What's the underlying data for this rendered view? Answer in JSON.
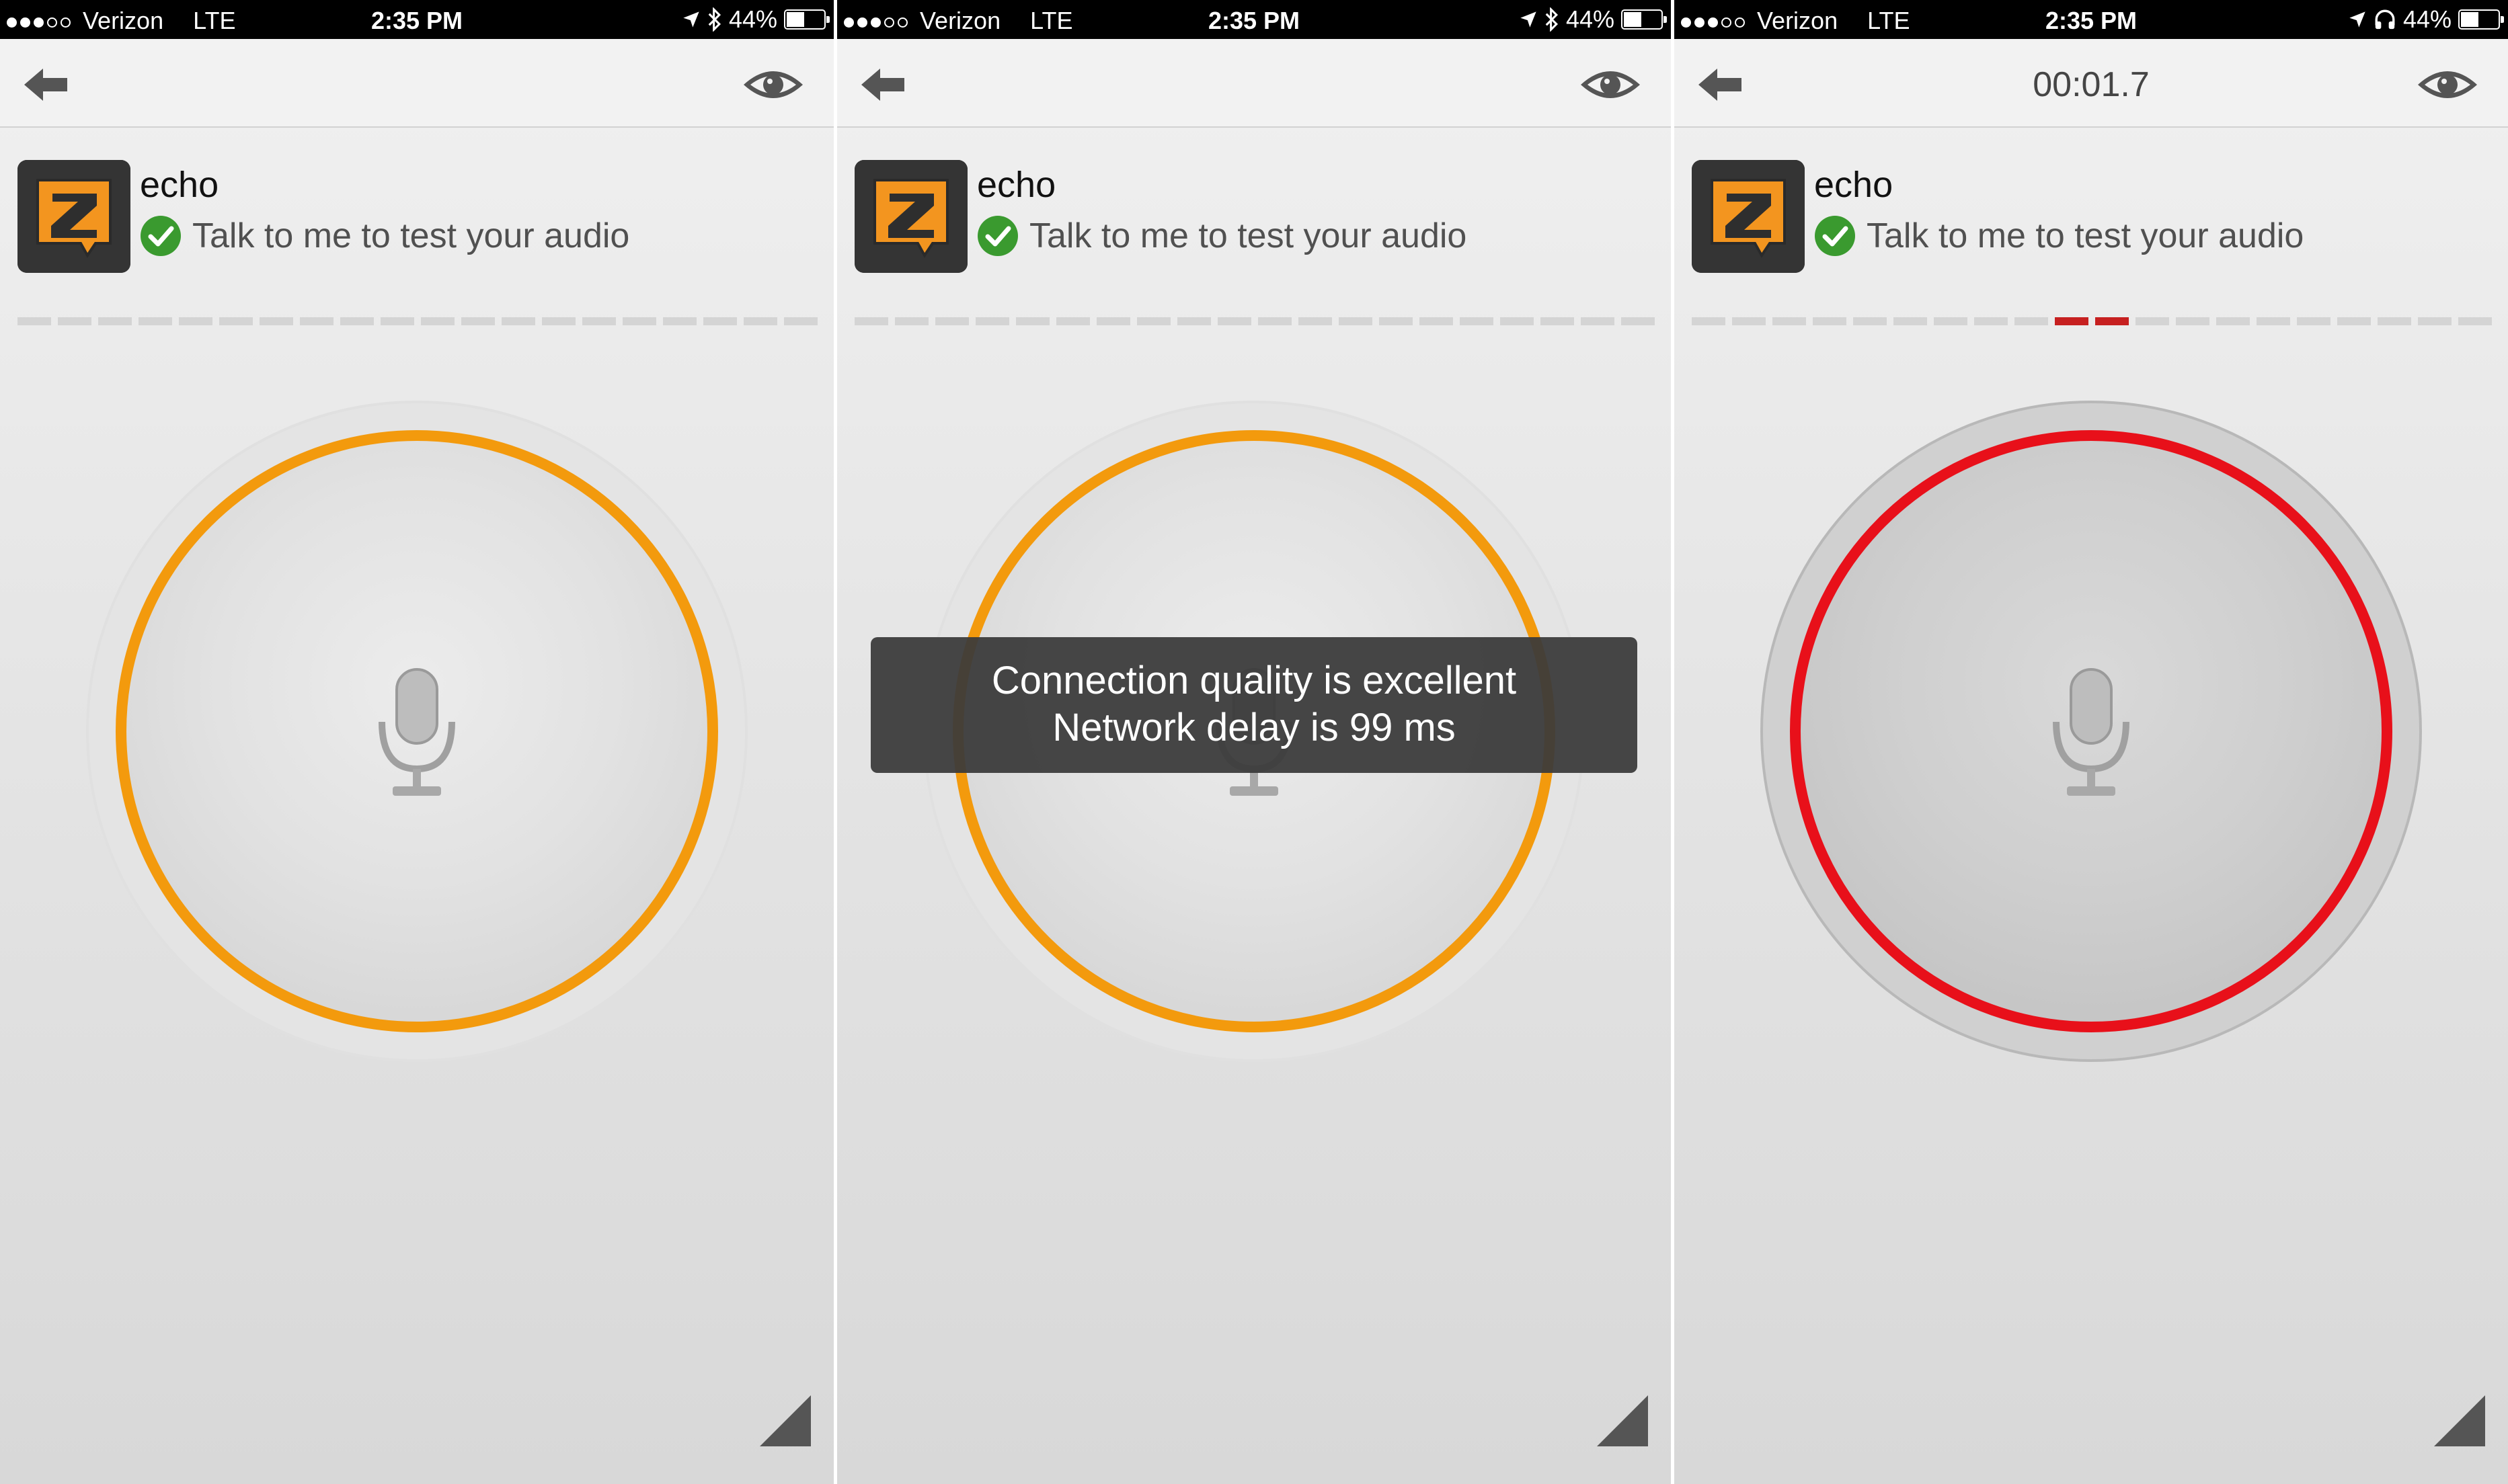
{
  "colors": {
    "orange": "#f39a0d",
    "red": "#e8101a",
    "check_green": "#3a9a2f",
    "logo_orange": "#f3951f"
  },
  "screens": [
    {
      "status": {
        "carrier": "Verizon",
        "network": "LTE",
        "time": "2:35 PM",
        "battery": "44%",
        "audio_icon": "bluetooth-icon"
      },
      "nav": {
        "timer": ""
      },
      "contact": {
        "name": "echo",
        "status": "Talk to me to test your audio"
      },
      "meter": {
        "segments": 20,
        "active": []
      },
      "ring_color": "orange",
      "toast": null
    },
    {
      "status": {
        "carrier": "Verizon",
        "network": "LTE",
        "time": "2:35 PM",
        "battery": "44%",
        "audio_icon": "bluetooth-icon"
      },
      "nav": {
        "timer": ""
      },
      "contact": {
        "name": "echo",
        "status": "Talk to me to test your audio"
      },
      "meter": {
        "segments": 20,
        "active": []
      },
      "ring_color": "orange",
      "toast": {
        "line1": "Connection quality is excellent",
        "line2": "Network delay is 99 ms"
      }
    },
    {
      "status": {
        "carrier": "Verizon",
        "network": "LTE",
        "time": "2:35 PM",
        "battery": "44%",
        "audio_icon": "headphones-icon"
      },
      "nav": {
        "timer": "00:01.7"
      },
      "contact": {
        "name": "echo",
        "status": "Talk to me to test your audio"
      },
      "meter": {
        "segments": 20,
        "active": [
          9,
          10
        ]
      },
      "ring_color": "red",
      "toast": null
    }
  ]
}
